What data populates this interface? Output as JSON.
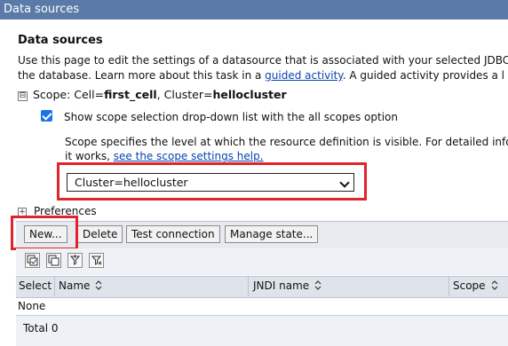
{
  "window": {
    "title": "Data sources"
  },
  "page": {
    "heading": "Data sources",
    "desc_line1": "Use this page to edit the settings of a datasource that is associated with your selected JDBC",
    "desc_line2_pre": "the database. Learn more about this task in a ",
    "desc_link": "guided activity",
    "desc_line2_post": ". A guided activity provides a l"
  },
  "scope": {
    "toggle_symbol": "⊟",
    "prefix": "Scope: Cell=",
    "cell": "first_cell",
    "mid": ", Cluster=",
    "cluster": "hellocluster",
    "checkbox_label": "Show scope selection drop-down list with the all scopes option",
    "checkbox_checked": true,
    "help_line1": "Scope specifies the level at which the resource definition is visible. For detailed info",
    "help_line2_pre": "it works, ",
    "help_link": "see the scope settings help.",
    "select_value": "Cluster=hellocluster"
  },
  "preferences": {
    "toggle_symbol": "+",
    "label": "Preferences"
  },
  "toolbar": {
    "new": "New...",
    "delete": "Delete",
    "test_connection": "Test connection",
    "manage_state": "Manage state..."
  },
  "icons": [
    "select-all-icon",
    "deselect-all-icon",
    "show-filter-icon",
    "clear-filter-icon"
  ],
  "table": {
    "columns": [
      "Select",
      "Name",
      "JNDI name",
      "Scope"
    ],
    "empty_text": "None",
    "total_label": "Total 0"
  },
  "colors": {
    "titlebar": "#5a7ba8",
    "highlight": "#e0242c",
    "link": "#0645ad",
    "checkbox": "#1a73e8"
  }
}
